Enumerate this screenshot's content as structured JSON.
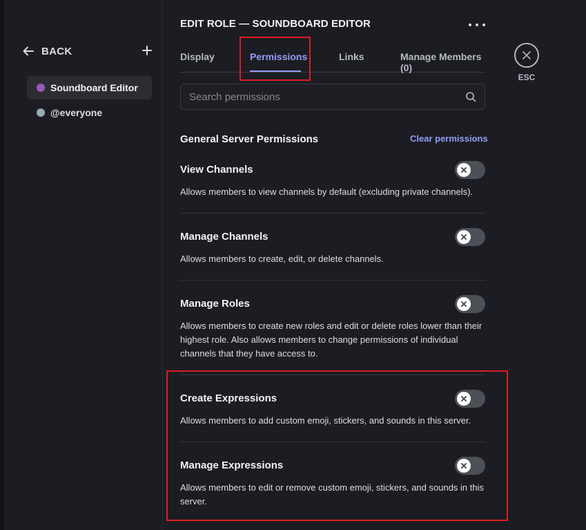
{
  "sidebar": {
    "back_label": "BACK",
    "roles": [
      {
        "label": "Soundboard Editor",
        "color": "#9b59b6",
        "selected": true
      },
      {
        "label": "@everyone",
        "color": "#99aab5",
        "selected": false
      }
    ]
  },
  "header": {
    "title": "EDIT ROLE — SOUNDBOARD EDITOR",
    "tabs": [
      {
        "label": "Display"
      },
      {
        "label": "Permissions",
        "active": true
      },
      {
        "label": "Links"
      },
      {
        "label": "Manage Members (0)"
      }
    ],
    "esc_label": "ESC"
  },
  "search": {
    "placeholder": "Search permissions"
  },
  "section": {
    "title": "General Server Permissions",
    "clear_label": "Clear permissions"
  },
  "permissions": [
    {
      "name": "View Channels",
      "description": "Allows members to view channels by default (excluding private channels).",
      "enabled": false
    },
    {
      "name": "Manage Channels",
      "description": "Allows members to create, edit, or delete channels.",
      "enabled": false
    },
    {
      "name": "Manage Roles",
      "description": "Allows members to create new roles and edit or delete roles lower than their highest role. Also allows members to change permissions of individual channels that they have access to.",
      "enabled": false
    },
    {
      "name": "Create Expressions",
      "description": "Allows members to add custom emoji, stickers, and sounds in this server.",
      "enabled": false
    },
    {
      "name": "Manage Expressions",
      "description": "Allows members to edit or remove custom emoji, stickers, and sounds in this server.",
      "enabled": false
    }
  ],
  "colors": {
    "accent": "#949cf7",
    "highlight": "#e01b24",
    "toggle_off": "#4e5058"
  },
  "icons": [
    "arrow-left-icon",
    "plus-icon",
    "more-horizontal-icon",
    "close-icon",
    "search-icon",
    "x-icon"
  ]
}
